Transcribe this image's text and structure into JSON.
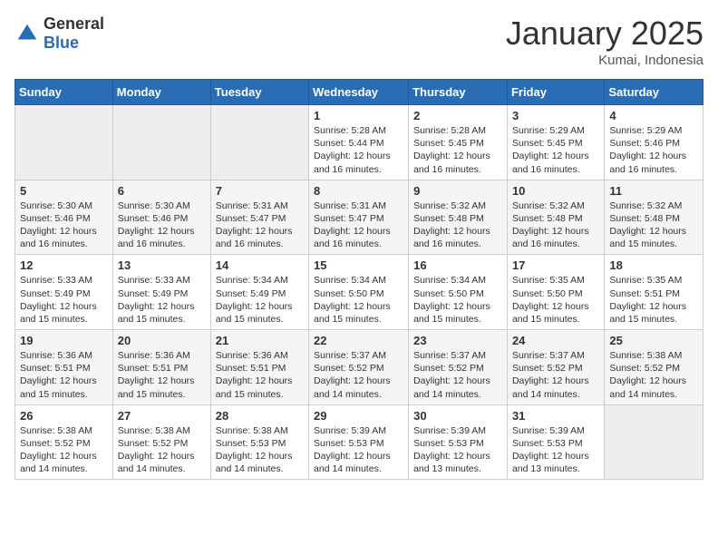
{
  "header": {
    "logo_general": "General",
    "logo_blue": "Blue",
    "title": "January 2025",
    "subtitle": "Kumai, Indonesia"
  },
  "weekdays": [
    "Sunday",
    "Monday",
    "Tuesday",
    "Wednesday",
    "Thursday",
    "Friday",
    "Saturday"
  ],
  "weeks": [
    [
      {
        "day": "",
        "info": ""
      },
      {
        "day": "",
        "info": ""
      },
      {
        "day": "",
        "info": ""
      },
      {
        "day": "1",
        "info": "Sunrise: 5:28 AM\nSunset: 5:44 PM\nDaylight: 12 hours\nand 16 minutes."
      },
      {
        "day": "2",
        "info": "Sunrise: 5:28 AM\nSunset: 5:45 PM\nDaylight: 12 hours\nand 16 minutes."
      },
      {
        "day": "3",
        "info": "Sunrise: 5:29 AM\nSunset: 5:45 PM\nDaylight: 12 hours\nand 16 minutes."
      },
      {
        "day": "4",
        "info": "Sunrise: 5:29 AM\nSunset: 5:46 PM\nDaylight: 12 hours\nand 16 minutes."
      }
    ],
    [
      {
        "day": "5",
        "info": "Sunrise: 5:30 AM\nSunset: 5:46 PM\nDaylight: 12 hours\nand 16 minutes."
      },
      {
        "day": "6",
        "info": "Sunrise: 5:30 AM\nSunset: 5:46 PM\nDaylight: 12 hours\nand 16 minutes."
      },
      {
        "day": "7",
        "info": "Sunrise: 5:31 AM\nSunset: 5:47 PM\nDaylight: 12 hours\nand 16 minutes."
      },
      {
        "day": "8",
        "info": "Sunrise: 5:31 AM\nSunset: 5:47 PM\nDaylight: 12 hours\nand 16 minutes."
      },
      {
        "day": "9",
        "info": "Sunrise: 5:32 AM\nSunset: 5:48 PM\nDaylight: 12 hours\nand 16 minutes."
      },
      {
        "day": "10",
        "info": "Sunrise: 5:32 AM\nSunset: 5:48 PM\nDaylight: 12 hours\nand 16 minutes."
      },
      {
        "day": "11",
        "info": "Sunrise: 5:32 AM\nSunset: 5:48 PM\nDaylight: 12 hours\nand 15 minutes."
      }
    ],
    [
      {
        "day": "12",
        "info": "Sunrise: 5:33 AM\nSunset: 5:49 PM\nDaylight: 12 hours\nand 15 minutes."
      },
      {
        "day": "13",
        "info": "Sunrise: 5:33 AM\nSunset: 5:49 PM\nDaylight: 12 hours\nand 15 minutes."
      },
      {
        "day": "14",
        "info": "Sunrise: 5:34 AM\nSunset: 5:49 PM\nDaylight: 12 hours\nand 15 minutes."
      },
      {
        "day": "15",
        "info": "Sunrise: 5:34 AM\nSunset: 5:50 PM\nDaylight: 12 hours\nand 15 minutes."
      },
      {
        "day": "16",
        "info": "Sunrise: 5:34 AM\nSunset: 5:50 PM\nDaylight: 12 hours\nand 15 minutes."
      },
      {
        "day": "17",
        "info": "Sunrise: 5:35 AM\nSunset: 5:50 PM\nDaylight: 12 hours\nand 15 minutes."
      },
      {
        "day": "18",
        "info": "Sunrise: 5:35 AM\nSunset: 5:51 PM\nDaylight: 12 hours\nand 15 minutes."
      }
    ],
    [
      {
        "day": "19",
        "info": "Sunrise: 5:36 AM\nSunset: 5:51 PM\nDaylight: 12 hours\nand 15 minutes."
      },
      {
        "day": "20",
        "info": "Sunrise: 5:36 AM\nSunset: 5:51 PM\nDaylight: 12 hours\nand 15 minutes."
      },
      {
        "day": "21",
        "info": "Sunrise: 5:36 AM\nSunset: 5:51 PM\nDaylight: 12 hours\nand 15 minutes."
      },
      {
        "day": "22",
        "info": "Sunrise: 5:37 AM\nSunset: 5:52 PM\nDaylight: 12 hours\nand 14 minutes."
      },
      {
        "day": "23",
        "info": "Sunrise: 5:37 AM\nSunset: 5:52 PM\nDaylight: 12 hours\nand 14 minutes."
      },
      {
        "day": "24",
        "info": "Sunrise: 5:37 AM\nSunset: 5:52 PM\nDaylight: 12 hours\nand 14 minutes."
      },
      {
        "day": "25",
        "info": "Sunrise: 5:38 AM\nSunset: 5:52 PM\nDaylight: 12 hours\nand 14 minutes."
      }
    ],
    [
      {
        "day": "26",
        "info": "Sunrise: 5:38 AM\nSunset: 5:52 PM\nDaylight: 12 hours\nand 14 minutes."
      },
      {
        "day": "27",
        "info": "Sunrise: 5:38 AM\nSunset: 5:52 PM\nDaylight: 12 hours\nand 14 minutes."
      },
      {
        "day": "28",
        "info": "Sunrise: 5:38 AM\nSunset: 5:53 PM\nDaylight: 12 hours\nand 14 minutes."
      },
      {
        "day": "29",
        "info": "Sunrise: 5:39 AM\nSunset: 5:53 PM\nDaylight: 12 hours\nand 14 minutes."
      },
      {
        "day": "30",
        "info": "Sunrise: 5:39 AM\nSunset: 5:53 PM\nDaylight: 12 hours\nand 13 minutes."
      },
      {
        "day": "31",
        "info": "Sunrise: 5:39 AM\nSunset: 5:53 PM\nDaylight: 12 hours\nand 13 minutes."
      },
      {
        "day": "",
        "info": ""
      }
    ]
  ]
}
